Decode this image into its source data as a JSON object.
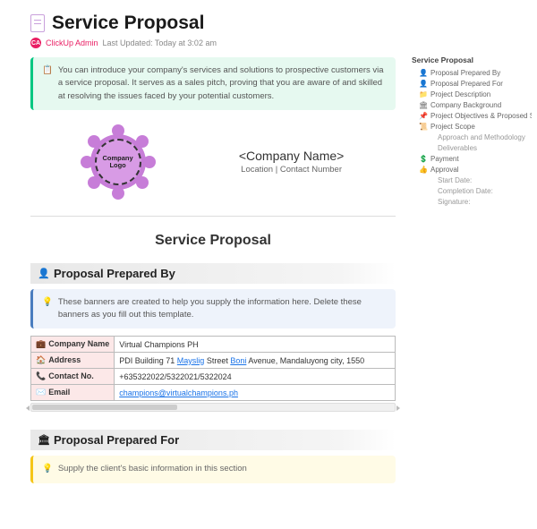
{
  "header": {
    "title": "Service Proposal",
    "author": "ClickUp Admin",
    "updated": "Last Updated: Today at 3:02 am"
  },
  "intro_callout": {
    "icon": "📋",
    "text": "You can introduce your company's services and solutions to prospective customers via a service proposal. It serves as a sales pitch, proving that you are aware of and skilled at resolving the issues faced by your potential customers."
  },
  "hero": {
    "logo_text": "Company Logo",
    "company_name": "<Company Name>",
    "company_location": "Location | Contact Number"
  },
  "doc_heading": "Service Proposal",
  "section_prepared_by": {
    "title": "Proposal Prepared By",
    "callout": "These banners are created to help you supply the information here. Delete these banners as you fill out this template.",
    "rows": {
      "name_label": "Company Name",
      "name_value": "Virtual Champions PH",
      "address_label": "Address",
      "address_value": "PDI Building 71 Mayslig Street Boni Avenue, Mandaluyong city, 1550",
      "contact_label": "Contact No.",
      "contact_value": "+635322022/5322021/5322024",
      "email_label": "Email",
      "email_value": "champions@virtualchampions.ph"
    }
  },
  "section_prepared_for": {
    "title": "Proposal Prepared For",
    "callout": "Supply the client's basic information in this section"
  },
  "outline": {
    "title": "Service Proposal",
    "items": [
      {
        "icon": "👤",
        "label": "Proposal Prepared By"
      },
      {
        "icon": "👤",
        "label": "Proposal Prepared For"
      },
      {
        "icon": "📁",
        "label": "Project Description"
      },
      {
        "icon": "🏛",
        "label": "Company Background"
      },
      {
        "icon": "📌",
        "label": "Project Objectives & Proposed Ser…"
      },
      {
        "icon": "📜",
        "label": "Project Scope"
      },
      {
        "icon": "",
        "label": "Approach and Methodology",
        "sub": true
      },
      {
        "icon": "",
        "label": "Deliverables",
        "sub": true
      },
      {
        "icon": "💲",
        "label": "Payment"
      },
      {
        "icon": "👍",
        "label": "Approval"
      },
      {
        "icon": "",
        "label": "Start Date:",
        "sub": true
      },
      {
        "icon": "",
        "label": "Completion Date:",
        "sub": true
      },
      {
        "icon": "",
        "label": "Signature:",
        "sub": true
      }
    ]
  }
}
